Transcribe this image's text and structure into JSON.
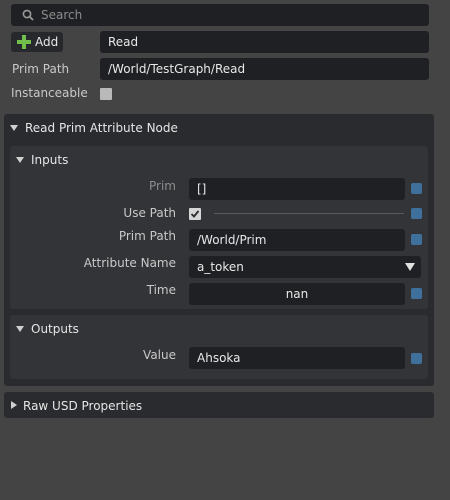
{
  "search": {
    "placeholder": "Search"
  },
  "toolbar": {
    "add_label": "Add",
    "name_value": "Read"
  },
  "prim": {
    "label": "Prim Path",
    "value": "/World/TestGraph/Read"
  },
  "instanceable": {
    "label": "Instanceable",
    "checked": false
  },
  "node_section": {
    "title": "Read Prim Attribute Node",
    "inputs": {
      "title": "Inputs",
      "prim": {
        "label": "Prim",
        "value": "[]"
      },
      "use_path": {
        "label": "Use Path",
        "checked": true
      },
      "prim_path": {
        "label": "Prim Path",
        "value": "/World/Prim"
      },
      "attribute_name": {
        "label": "Attribute Name",
        "value": "a_token"
      },
      "time": {
        "label": "Time",
        "value": "nan"
      }
    },
    "outputs": {
      "title": "Outputs",
      "value": {
        "label": "Value",
        "value": "Ahsoka"
      }
    }
  },
  "raw_usd": {
    "title": "Raw USD Properties"
  },
  "colors": {
    "background": "#444444",
    "field": "#1f2023",
    "accent_square": "#3f6f9b",
    "add_plus": "#6fbf4a"
  }
}
